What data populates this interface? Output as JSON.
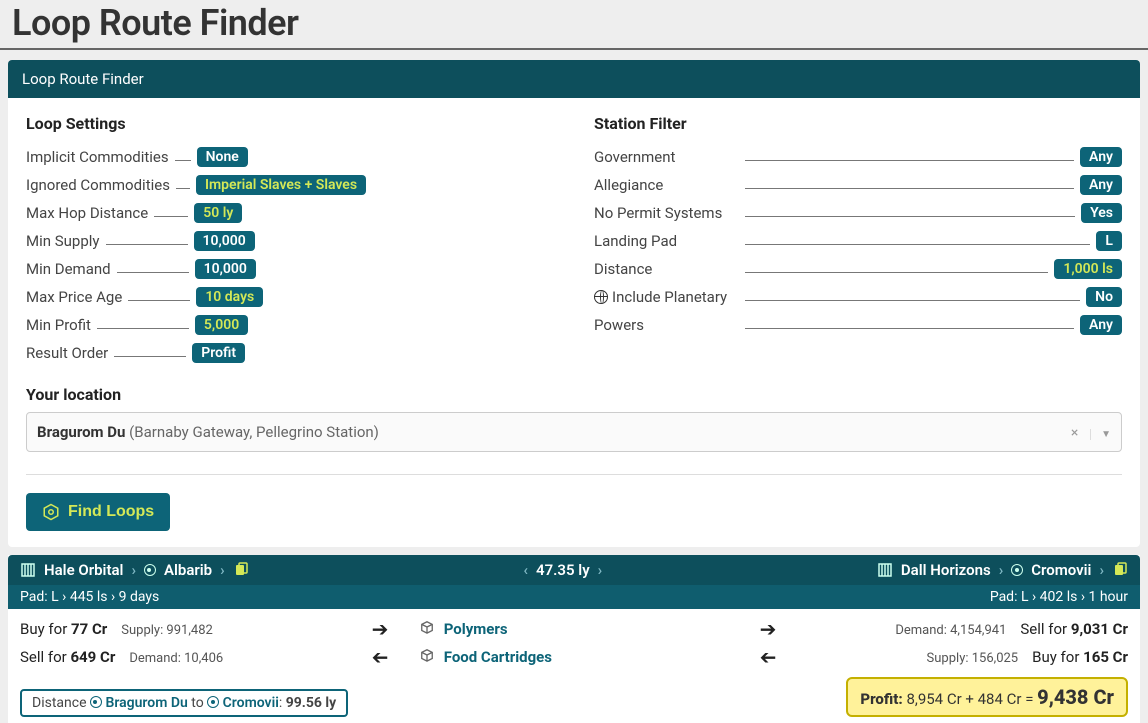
{
  "page_title": "Loop Route Finder",
  "panel_title": "Loop Route Finder",
  "sections": {
    "loop_settings_heading": "Loop Settings",
    "station_filter_heading": "Station Filter",
    "location_heading": "Your location"
  },
  "loop_settings": {
    "implicit_commodities": {
      "label": "Implicit Commodities",
      "value": "None",
      "highlight": false
    },
    "ignored_commodities": {
      "label": "Ignored Commodities",
      "value": "Imperial Slaves + Slaves",
      "highlight": true
    },
    "max_hop_distance": {
      "label": "Max Hop Distance",
      "value": "50 ly",
      "highlight": true
    },
    "min_supply": {
      "label": "Min Supply",
      "value": "10,000",
      "highlight": false
    },
    "min_demand": {
      "label": "Min Demand",
      "value": "10,000",
      "highlight": false
    },
    "max_price_age": {
      "label": "Max Price Age",
      "value": "10 days",
      "highlight": true
    },
    "min_profit": {
      "label": "Min Profit",
      "value": "5,000",
      "highlight": true
    },
    "result_order": {
      "label": "Result Order",
      "value": "Profit",
      "highlight": false
    }
  },
  "station_filter": {
    "government": {
      "label": "Government",
      "value": "Any",
      "highlight": false
    },
    "allegiance": {
      "label": "Allegiance",
      "value": "Any",
      "highlight": false
    },
    "no_permit_systems": {
      "label": "No Permit Systems",
      "value": "Yes",
      "highlight": false
    },
    "landing_pad": {
      "label": "Landing Pad",
      "value": "L",
      "highlight": false
    },
    "distance": {
      "label": "Distance",
      "value": "1,000 ls",
      "highlight": true
    },
    "include_planetary": {
      "label": "Include Planetary",
      "value": "No",
      "highlight": false,
      "icon": "globe"
    },
    "powers": {
      "label": "Powers",
      "value": "Any",
      "highlight": false
    }
  },
  "location": {
    "system": "Bragurom Du",
    "stations": " (Barnaby Gateway, Pellegrino Station)"
  },
  "find_button": "Find Loops",
  "result": {
    "left_station": "Hale Orbital",
    "left_system": "Albarib",
    "center_distance": "47.35 ly",
    "right_station": "Dall Horizons",
    "right_system": "Cromovii",
    "left_sub": "Pad: L  ›  445 ls  ›  9 days",
    "right_sub": "Pad: L  ›  402 ls  ›  1 hour",
    "row1": {
      "buy_text": "Buy for ",
      "buy_price": "77 Cr",
      "supply_label": "Supply: 991,482",
      "commodity": "Polymers",
      "demand_label": "Demand: 4,154,941",
      "sell_text": "Sell for ",
      "sell_price": "9,031 Cr"
    },
    "row2": {
      "sell_text": "Sell for ",
      "sell_price": "649 Cr",
      "demand_label": "Demand: 10,406",
      "commodity": "Food Cartridges",
      "supply_label": "Supply: 156,025",
      "buy_text": "Buy for ",
      "buy_price": "165 Cr"
    },
    "distance_prefix": "Distance ",
    "distance_from": "Bragurom Du",
    "distance_to_word": " to ",
    "distance_to": "Cromovii",
    "distance_value": "99.56 ly",
    "profit_label": "Profit: ",
    "profit_parts": "8,954 Cr + 484 Cr = ",
    "profit_total": "9,438 Cr"
  }
}
